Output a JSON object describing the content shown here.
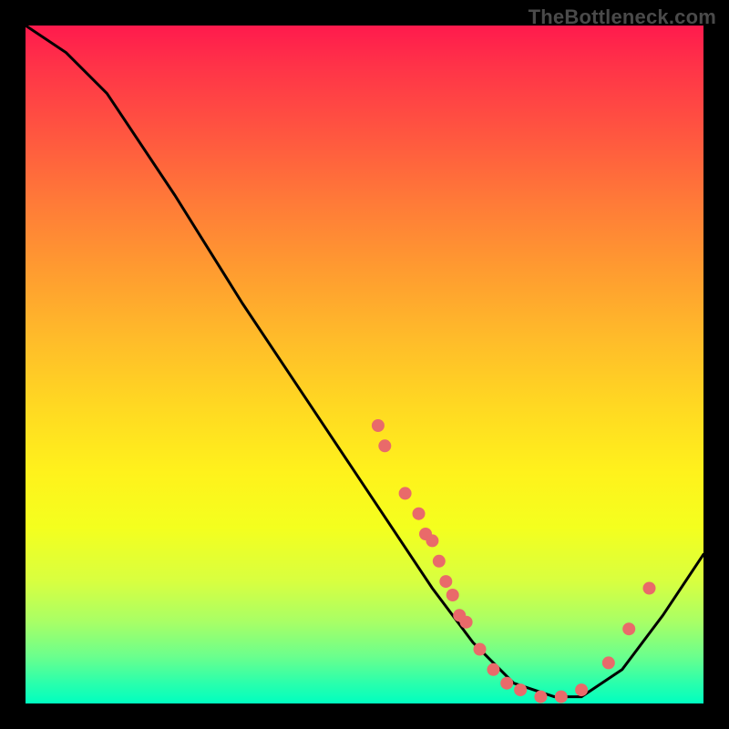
{
  "watermark": "TheBottleneck.com",
  "chart_data": {
    "type": "line",
    "title": "",
    "xlabel": "",
    "ylabel": "",
    "xlim": [
      0,
      100
    ],
    "ylim": [
      0,
      100
    ],
    "grid": false,
    "legend": false,
    "note": "Axes unlabeled; values below are percent estimates from the image.",
    "curve": {
      "name": "metric",
      "color": "#000000",
      "points": [
        {
          "x": 0,
          "y": 100
        },
        {
          "x": 6,
          "y": 96
        },
        {
          "x": 12,
          "y": 90
        },
        {
          "x": 22,
          "y": 75
        },
        {
          "x": 32,
          "y": 59
        },
        {
          "x": 42,
          "y": 44
        },
        {
          "x": 52,
          "y": 29
        },
        {
          "x": 60,
          "y": 17
        },
        {
          "x": 66,
          "y": 9
        },
        {
          "x": 72,
          "y": 3
        },
        {
          "x": 78,
          "y": 1
        },
        {
          "x": 82,
          "y": 1
        },
        {
          "x": 88,
          "y": 5
        },
        {
          "x": 94,
          "y": 13
        },
        {
          "x": 100,
          "y": 22
        }
      ]
    },
    "markers": {
      "name": "samples",
      "color": "#e96a6a",
      "radius_px": 7,
      "points": [
        {
          "x": 52,
          "y": 41
        },
        {
          "x": 53,
          "y": 38
        },
        {
          "x": 56,
          "y": 31
        },
        {
          "x": 58,
          "y": 28
        },
        {
          "x": 59,
          "y": 25
        },
        {
          "x": 60,
          "y": 24
        },
        {
          "x": 61,
          "y": 21
        },
        {
          "x": 62,
          "y": 18
        },
        {
          "x": 63,
          "y": 16
        },
        {
          "x": 64,
          "y": 13
        },
        {
          "x": 65,
          "y": 12
        },
        {
          "x": 67,
          "y": 8
        },
        {
          "x": 69,
          "y": 5
        },
        {
          "x": 71,
          "y": 3
        },
        {
          "x": 73,
          "y": 2
        },
        {
          "x": 76,
          "y": 1
        },
        {
          "x": 79,
          "y": 1
        },
        {
          "x": 82,
          "y": 2
        },
        {
          "x": 86,
          "y": 6
        },
        {
          "x": 89,
          "y": 11
        },
        {
          "x": 92,
          "y": 17
        }
      ]
    }
  }
}
